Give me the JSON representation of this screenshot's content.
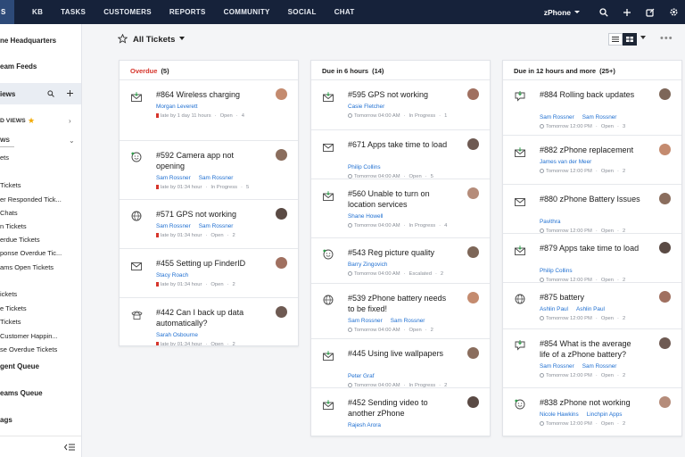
{
  "nav": {
    "active": "S",
    "items": [
      "KB",
      "TASKS",
      "CUSTOMERS",
      "REPORTS",
      "COMMUNITY",
      "SOCIAL",
      "CHAT"
    ],
    "brand": "zPhone"
  },
  "sidebar": {
    "headquarters": "ne Headquarters",
    "team_feeds": "eam Feeds",
    "views": "iews",
    "starred": "D VIEWS",
    "ews": "WS",
    "items": [
      "ets",
      "Tickets",
      "er Responded Tick...",
      "Chats",
      "n Tickets",
      "erdue Tickets",
      "ponse Overdue Tic...",
      "ams Open Tickets",
      "ickets",
      "e Tickets",
      "Tickets",
      "Customer Happin...",
      "se Overdue Tickets"
    ],
    "agent_queue": "gent Queue",
    "teams_queue": "eams Queue",
    "tags": "ags"
  },
  "header": {
    "title": "All Tickets"
  },
  "columns": [
    {
      "title": "Overdue",
      "count": "(5)",
      "tickets": [
        {
          "icon": "email-icon",
          "title": "#864 Wireless charging",
          "people": [
            "Morgan Leverett"
          ],
          "meta_prefix": "late by 1 day 11 hours",
          "status": "Open",
          "count": "4"
        },
        {
          "icon": "feedback-icon",
          "title": "#592 Camera app not opening",
          "people": [
            "Sam Rossner",
            "Sam Rossner"
          ],
          "meta_prefix": "late by 01:34 hour",
          "status": "In Progress",
          "count": "5"
        },
        {
          "icon": "web-icon",
          "title": "#571 GPS not working",
          "people": [
            "Sam Rossner",
            "Sam Rossner"
          ],
          "meta_prefix": "late by 01:34 hour",
          "status": "Open",
          "count": "2"
        },
        {
          "icon": "mail-icon",
          "title": "#455 Setting up FinderID",
          "people": [
            "Stacy Roach"
          ],
          "meta_prefix": "late by 01:34 hour",
          "status": "Open",
          "count": "2"
        },
        {
          "icon": "phone-icon",
          "title": "#442 Can I back up data automatically?",
          "people": [
            "Sarah Osbourne"
          ],
          "meta_prefix": "late by 01:34 hour",
          "status": "Open",
          "count": "2"
        }
      ]
    },
    {
      "title": "Due in 6 hours",
      "count": "(14)",
      "tickets": [
        {
          "icon": "email-icon",
          "title": "#595 GPS not working",
          "people": [
            "Casie Fletcher"
          ],
          "meta_prefix": "Tomorrow 04:00 AM",
          "status": "In Progress",
          "count": "1"
        },
        {
          "icon": "mail-icon",
          "title": "#671 Apps take time to load",
          "people": [
            "Philip Collins"
          ],
          "meta_prefix": "Tomorrow 04:00 AM",
          "status": "Open",
          "count": "5"
        },
        {
          "icon": "email-icon",
          "title": "#560 Unable to turn on location services",
          "people": [
            "Shane Howell"
          ],
          "meta_prefix": "Tomorrow 04:00 AM",
          "status": "In Progress",
          "count": "4"
        },
        {
          "icon": "feedback-icon",
          "title": "#543 Reg picture quality",
          "people": [
            "Barry Zingovich"
          ],
          "meta_prefix": "Tomorrow 04:00 AM",
          "status": "Escalated",
          "count": "2"
        },
        {
          "icon": "web-icon",
          "title": "#539 zPhone battery needs to be fixed!",
          "people": [
            "Sam Rossner",
            "Sam Rossner"
          ],
          "meta_prefix": "Tomorrow 04:00 AM",
          "status": "Open",
          "count": "2"
        },
        {
          "icon": "email-icon",
          "title": "#445 Using live wallpapers",
          "people": [
            "Peter Graf"
          ],
          "meta_prefix": "Tomorrow 04:00 AM",
          "status": "In Progress",
          "count": "2"
        },
        {
          "icon": "email-icon",
          "title": "#452 Sending video to another zPhone",
          "people": [
            "Rajesh Arora"
          ],
          "meta_prefix": "",
          "status": "",
          "count": ""
        }
      ]
    },
    {
      "title": "Due in 12 hours and more",
      "count": "(25+)",
      "tickets": [
        {
          "icon": "forum-icon",
          "title": "#884 Rolling back updates",
          "people": [
            "Sam Rossner",
            "Sam Rossner"
          ],
          "meta_prefix": "Tomorrow 12:00 PM",
          "status": "Open",
          "count": "3"
        },
        {
          "icon": "email-icon",
          "title": "#882 zPhone replacement",
          "people": [
            "James van der Meer"
          ],
          "meta_prefix": "Tomorrow 12:00 PM",
          "status": "Open",
          "count": "2"
        },
        {
          "icon": "mail-icon",
          "title": "#880 zPhone Battery Issues",
          "people": [
            "Pavithra"
          ],
          "meta_prefix": "Tomorrow 12:00 PM",
          "status": "Open",
          "count": "2"
        },
        {
          "icon": "email-icon",
          "title": "#879 Apps take time to load",
          "people": [
            "Philip Collins"
          ],
          "meta_prefix": "Tomorrow 12:00 PM",
          "status": "Open",
          "count": "2"
        },
        {
          "icon": "web-icon",
          "title": "#875 battery",
          "people": [
            "Ashlin Paul",
            "Ashlin Paul"
          ],
          "meta_prefix": "Tomorrow 12:00 PM",
          "status": "Open",
          "count": "2"
        },
        {
          "icon": "forum-icon",
          "title": "#854 What is the average life of a zPhone battery?",
          "people": [
            "Sam Rossner",
            "Sam Rossner"
          ],
          "meta_prefix": "Tomorrow 12:00 PM",
          "status": "Open",
          "count": "2"
        },
        {
          "icon": "feedback-icon",
          "title": "#838 zPhone not working",
          "people": [
            "Nicole Hawkins",
            "Linchpin Apps"
          ],
          "meta_prefix": "Tomorrow 12:00 PM",
          "status": "Open",
          "count": "2"
        }
      ]
    }
  ],
  "colors": {
    "topbar": "#16223a",
    "overdue": "#d6352b",
    "link": "#1f6fd1",
    "star": "#f2a900"
  }
}
